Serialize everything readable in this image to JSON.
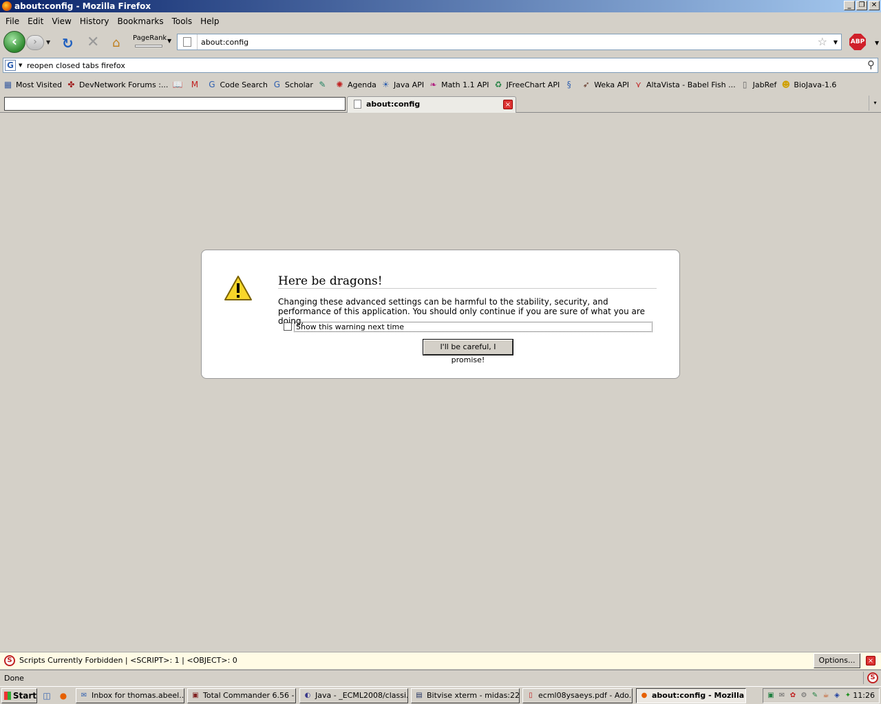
{
  "window": {
    "title": "about:config - Mozilla Firefox",
    "buttons": {
      "minimize": "_",
      "maximize": "❐",
      "close": "✕"
    }
  },
  "menu": [
    {
      "label": "File"
    },
    {
      "label": "Edit"
    },
    {
      "label": "View"
    },
    {
      "label": "History"
    },
    {
      "label": "Bookmarks"
    },
    {
      "label": "Tools"
    },
    {
      "label": "Help"
    }
  ],
  "navbar": {
    "pagerank_label": "PageRank",
    "url": "about:config"
  },
  "searchbar": {
    "engine": "G",
    "query": "reopen closed tabs firefox"
  },
  "bookmarks": [
    {
      "label": "Most Visited",
      "icon": "bookmark-folder-icon",
      "glyph": "▦",
      "color": "#3a5da0"
    },
    {
      "label": "DevNetwork Forums :...",
      "icon": "devnetwork-icon",
      "glyph": "✤",
      "color": "#a02020"
    },
    {
      "label": "",
      "icon": "book-icon",
      "glyph": "📖",
      "color": "#3a5da0"
    },
    {
      "label": "",
      "icon": "gmail-icon",
      "glyph": "M",
      "color": "#c02020"
    },
    {
      "label": "Code Search",
      "icon": "google-icon",
      "glyph": "G",
      "color": "#3060b0"
    },
    {
      "label": "Scholar",
      "icon": "google-icon",
      "glyph": "G",
      "color": "#3060b0"
    },
    {
      "label": "",
      "icon": "pen-icon",
      "glyph": "✎",
      "color": "#208060"
    },
    {
      "label": "Agenda",
      "icon": "gear-icon",
      "glyph": "✺",
      "color": "#c02020"
    },
    {
      "label": "Java API",
      "icon": "sun-icon",
      "glyph": "☀",
      "color": "#3060b0"
    },
    {
      "label": "Math 1.1 API",
      "icon": "feather-icon",
      "glyph": "❧",
      "color": "#b02080"
    },
    {
      "label": "JFreeChart API",
      "icon": "recycle-icon",
      "glyph": "♻",
      "color": "#208040"
    },
    {
      "label": "",
      "icon": "dna-icon",
      "glyph": "§",
      "color": "#3060b0"
    },
    {
      "label": "Weka API",
      "icon": "bird-icon",
      "glyph": "➶",
      "color": "#603020"
    },
    {
      "label": "AltaVista - Babel Fish ...",
      "icon": "altavista-icon",
      "glyph": "⋎",
      "color": "#c02020"
    },
    {
      "label": "JabRef",
      "icon": "page-icon",
      "glyph": "▯",
      "color": "#666666"
    },
    {
      "label": "BioJava-1.6",
      "icon": "smiley-icon",
      "glyph": "☻",
      "color": "#d0a000"
    }
  ],
  "tabs": {
    "active_label": "about:config",
    "close_glyph": "×",
    "list_glyph": "▾"
  },
  "warning": {
    "title": "Here be dragons!",
    "text": "Changing these advanced settings can be harmful to the stability, security, and performance of this application. You should only continue if you are sure of what you are doing.",
    "checkbox_label": "Show this warning next time",
    "checkbox_checked": false,
    "button_label": "I'll be careful, I promise!"
  },
  "noscript": {
    "message": "Scripts Currently Forbidden | <SCRIPT>: 1 | <OBJECT>: 0",
    "options_label": "Options...",
    "close_glyph": "×"
  },
  "status": {
    "text": "Done"
  },
  "taskbar": {
    "start_label": "Start",
    "tasks": [
      {
        "label": "Inbox for thomas.abeel...",
        "icon": "thunderbird-icon",
        "glyph": "✉",
        "color": "#3060b0"
      },
      {
        "label": "Total Commander 6.56 - ...",
        "icon": "floppy-icon",
        "glyph": "▣",
        "color": "#802020"
      },
      {
        "label": "Java - _ECML2008/classi...",
        "icon": "eclipse-icon",
        "glyph": "◐",
        "color": "#3a3a8a"
      },
      {
        "label": "Bitvise xterm - midas:22",
        "icon": "terminal-icon",
        "glyph": "▤",
        "color": "#203060"
      },
      {
        "label": "ecml08ysaeys.pdf - Ado...",
        "icon": "pdf-icon",
        "glyph": "▯",
        "color": "#c02020"
      },
      {
        "label": "about:config - Mozilla ...",
        "icon": "firefox-icon",
        "glyph": "●",
        "color": "#e66000",
        "active": true
      }
    ],
    "clock": "11:26"
  }
}
